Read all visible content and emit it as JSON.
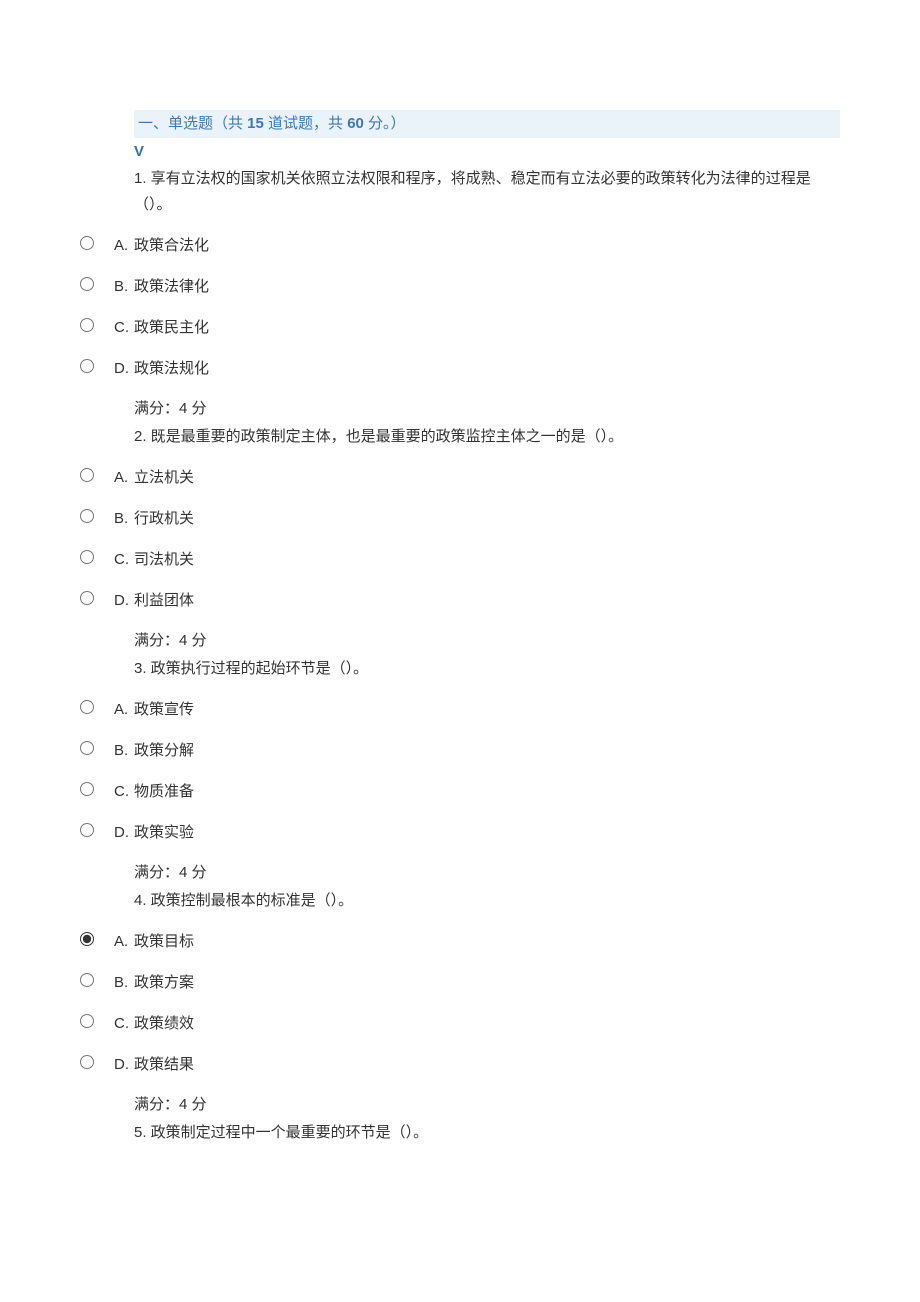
{
  "section": {
    "title_prefix": "一、单选题（共 ",
    "count": "15",
    "title_mid": " 道试题，共 ",
    "total_score": "60",
    "title_suffix": " 分。）",
    "v": "V"
  },
  "score_label": "满分：4 分",
  "questions": [
    {
      "num": "1.",
      "text": " 享有立法权的国家机关依照立法权限和程序，将成熟、稳定而有立法必要的政策转化为法律的过程是（）。",
      "options": [
        {
          "letter": "A.",
          "text": "政策合法化",
          "selected": false
        },
        {
          "letter": "B.",
          "text": "政策法律化",
          "selected": false
        },
        {
          "letter": "C.",
          "text": "政策民主化",
          "selected": false
        },
        {
          "letter": "D.",
          "text": "政策法规化",
          "selected": false
        }
      ]
    },
    {
      "num": "2.",
      "text": " 既是最重要的政策制定主体，也是最重要的政策监控主体之一的是（）。",
      "options": [
        {
          "letter": "A.",
          "text": "立法机关",
          "selected": false
        },
        {
          "letter": "B.",
          "text": "行政机关",
          "selected": false
        },
        {
          "letter": "C.",
          "text": "司法机关",
          "selected": false
        },
        {
          "letter": "D.",
          "text": "利益团体",
          "selected": false
        }
      ]
    },
    {
      "num": "3.",
      "text": " 政策执行过程的起始环节是（）。",
      "options": [
        {
          "letter": "A.",
          "text": "政策宣传",
          "selected": false
        },
        {
          "letter": "B.",
          "text": "政策分解",
          "selected": false
        },
        {
          "letter": "C.",
          "text": "物质准备",
          "selected": false
        },
        {
          "letter": "D.",
          "text": "政策实验",
          "selected": false
        }
      ]
    },
    {
      "num": "4.",
      "text": " 政策控制最根本的标准是（）。",
      "options": [
        {
          "letter": "A.",
          "text": "政策目标",
          "selected": true
        },
        {
          "letter": "B.",
          "text": "政策方案",
          "selected": false
        },
        {
          "letter": "C.",
          "text": "政策绩效",
          "selected": false
        },
        {
          "letter": "D.",
          "text": "政策结果",
          "selected": false
        }
      ]
    },
    {
      "num": "5.",
      "text": " 政策制定过程中一个最重要的环节是（）。",
      "options": []
    }
  ]
}
